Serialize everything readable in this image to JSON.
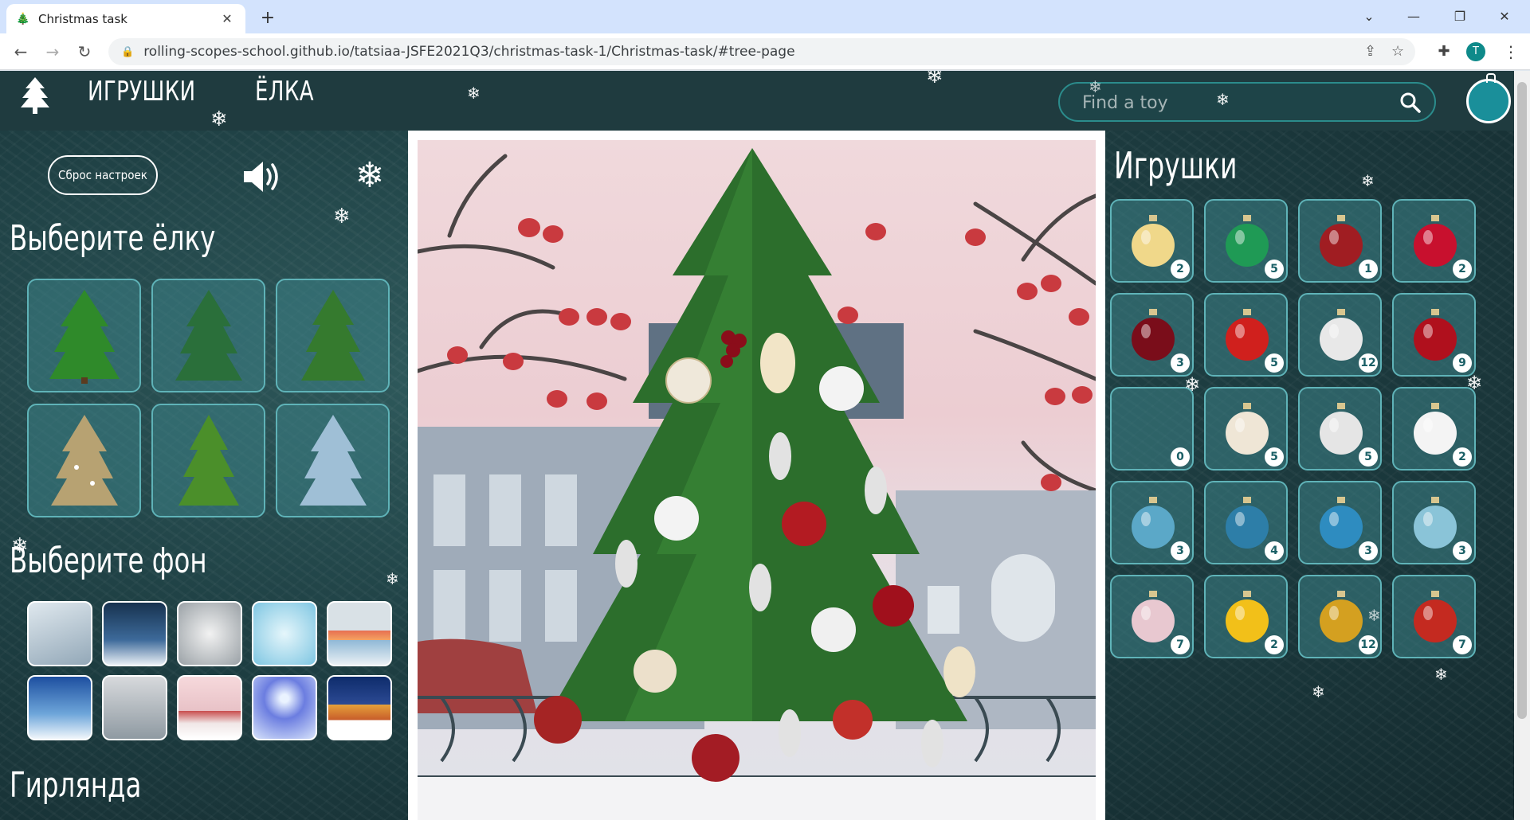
{
  "browser": {
    "tab_title": "Christmas task",
    "url": "rolling-scopes-school.github.io/tatsiaa-JSFE2021Q3/christmas-task-1/Christmas-task/#tree-page",
    "profile_initial": "T"
  },
  "header": {
    "nav_toys": "ИГРУШКИ",
    "nav_tree": "ЁЛКА",
    "search_placeholder": "Find a toy"
  },
  "settings": {
    "reset_label": "Сброс настроек"
  },
  "left_panel": {
    "choose_tree_title": "Выберите ёлку",
    "choose_bg_title": "Выберите фон",
    "garland_title": "Гирлянда"
  },
  "toys_panel": {
    "title": "Игрушки",
    "toys": [
      {
        "count": "2",
        "color": "#f0d88a"
      },
      {
        "count": "5",
        "color": "#1f9a55"
      },
      {
        "count": "1",
        "color": "#a01d22"
      },
      {
        "count": "2",
        "color": "#c8102e"
      },
      {
        "count": "3",
        "color": "#7a0d1a"
      },
      {
        "count": "5",
        "color": "#d0201d"
      },
      {
        "count": "12",
        "color": "#e8e8e8"
      },
      {
        "count": "9",
        "color": "#b0101d"
      },
      {
        "count": "0",
        "color": "transparent"
      },
      {
        "count": "5",
        "color": "#efe6d6"
      },
      {
        "count": "5",
        "color": "#e5e5e5"
      },
      {
        "count": "2",
        "color": "#f4f4f4"
      },
      {
        "count": "3",
        "color": "#5ba8c8"
      },
      {
        "count": "4",
        "color": "#2d7ea8"
      },
      {
        "count": "3",
        "color": "#2e8cc0"
      },
      {
        "count": "3",
        "color": "#8ac4d8"
      },
      {
        "count": "7",
        "color": "#e8c8d0"
      },
      {
        "count": "2",
        "color": "#f2c019"
      },
      {
        "count": "12",
        "color": "#d4a020"
      },
      {
        "count": "7",
        "color": "#c42a20"
      }
    ]
  }
}
